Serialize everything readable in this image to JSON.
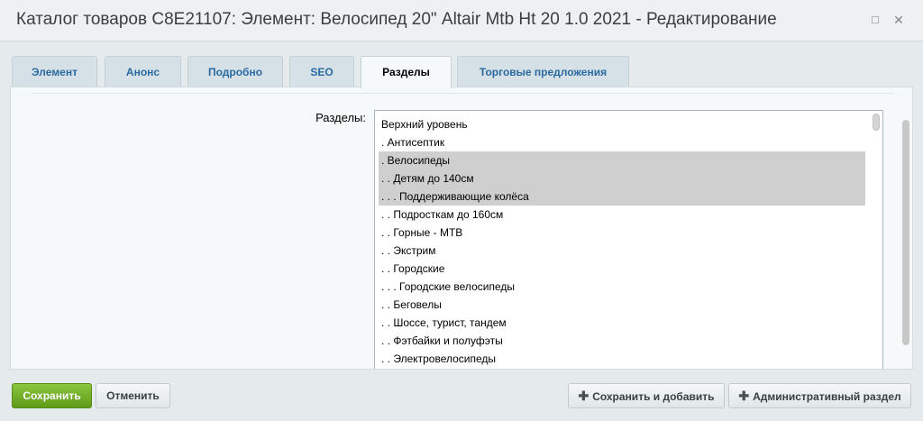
{
  "window": {
    "title": "Каталог товаров C8E21107: Элемент: Велосипед 20\" Altair Mtb Ht 20 1.0 2021 - Редактирование",
    "maximize_icon": "□",
    "close_icon": "✕"
  },
  "tabs": [
    {
      "label": "Элемент",
      "active": false
    },
    {
      "label": "Анонс",
      "active": false
    },
    {
      "label": "Подробно",
      "active": false
    },
    {
      "label": "SEO",
      "active": false
    },
    {
      "label": "Разделы",
      "active": true
    },
    {
      "label": "Торговые предложения",
      "active": false
    }
  ],
  "sections": {
    "label": "Разделы:",
    "items": [
      {
        "text": "Верхний уровень",
        "selected": false
      },
      {
        "text": ". Антисептик",
        "selected": false
      },
      {
        "text": ". Велосипеды",
        "selected": true
      },
      {
        "text": ". . Детям до 140см",
        "selected": true
      },
      {
        "text": ". . . Поддерживающие колёса",
        "selected": true
      },
      {
        "text": ". . Подросткам до 160см",
        "selected": false
      },
      {
        "text": ". . Горные - MTB",
        "selected": false
      },
      {
        "text": ". . Экстрим",
        "selected": false
      },
      {
        "text": ". . Городские",
        "selected": false
      },
      {
        "text": ". . . Городские велосипеды",
        "selected": false
      },
      {
        "text": ". . Беговелы",
        "selected": false
      },
      {
        "text": ". . Шоссе, турист, тандем",
        "selected": false
      },
      {
        "text": ". . Фэтбайки и полуфэты",
        "selected": false
      },
      {
        "text": ". . Электровелосипеды",
        "selected": false
      }
    ]
  },
  "footer": {
    "save_label": "Сохранить",
    "cancel_label": "Отменить",
    "save_add_label": "Сохранить и добавить",
    "admin_label": "Административный раздел",
    "plus_icon": "✚"
  },
  "colors": {
    "save_button": "#6dab1d",
    "tab_text": "#2b6aa1",
    "selected_item": "#cfcfcf"
  }
}
